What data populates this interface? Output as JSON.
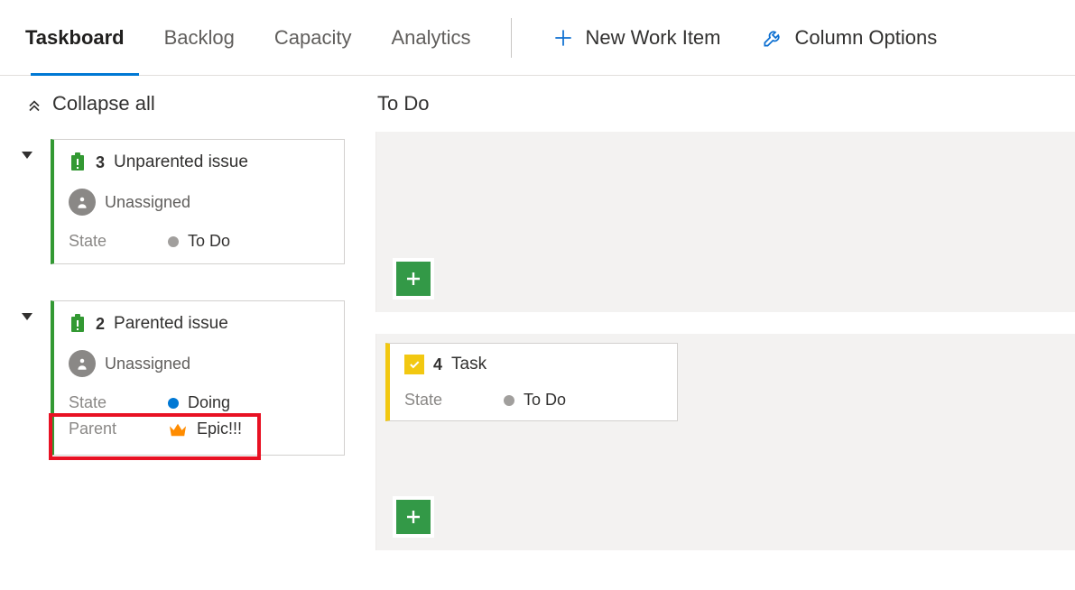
{
  "tabs": {
    "taskboard": "Taskboard",
    "backlog": "Backlog",
    "capacity": "Capacity",
    "analytics": "Analytics"
  },
  "actions": {
    "new_work_item": "New Work Item",
    "column_options": "Column Options"
  },
  "left": {
    "collapse_all": "Collapse all"
  },
  "column_header": "To Do",
  "row1": {
    "id": "3",
    "title": "Unparented issue",
    "assignee": "Unassigned",
    "state_label": "State",
    "state_value": "To Do"
  },
  "row2": {
    "id": "2",
    "title": "Parented issue",
    "assignee": "Unassigned",
    "state_label": "State",
    "state_value": "Doing",
    "parent_label": "Parent",
    "parent_value": "Epic!!!"
  },
  "task": {
    "id": "4",
    "title": "Task",
    "state_label": "State",
    "state_value": "To Do"
  }
}
